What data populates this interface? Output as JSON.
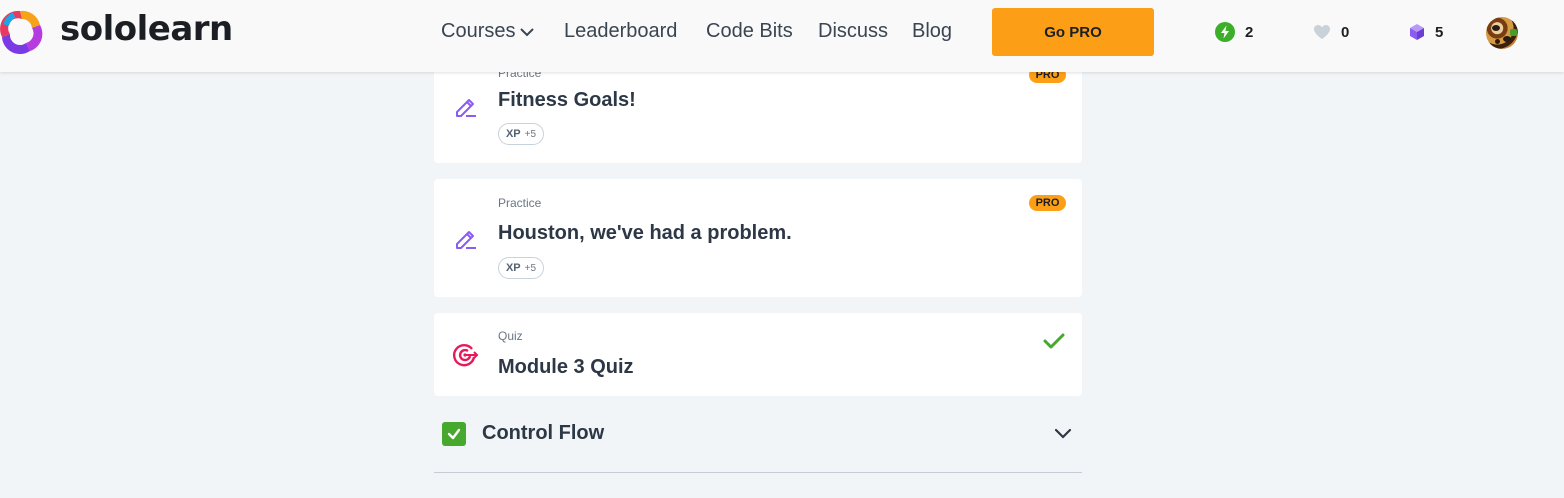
{
  "header": {
    "brand": "sololearn",
    "nav": {
      "courses": "Courses",
      "leaderboard": "Leaderboard",
      "code_bits": "Code Bits",
      "discuss": "Discuss",
      "blog": "Blog"
    },
    "go_pro": "Go PRO",
    "stats": {
      "streak": "2",
      "hearts": "0",
      "gems": "5"
    },
    "colors": {
      "go_pro": "#fd9f16",
      "streak": "#3cae2a",
      "gem": "#8a5cf0"
    }
  },
  "lessons": [
    {
      "type": "Practice",
      "title": "Fitness Goals!",
      "xp_label": "XP",
      "xp_value": "+5",
      "badge": "PRO",
      "icon": "edit-pencil-icon"
    },
    {
      "type": "Practice",
      "title": "Houston, we've had a problem.",
      "xp_label": "XP",
      "xp_value": "+5",
      "badge": "PRO",
      "icon": "edit-pencil-icon"
    },
    {
      "type": "Quiz",
      "title": "Module 3 Quiz",
      "completed": true,
      "icon": "target-icon"
    }
  ],
  "section": {
    "title": "Control Flow",
    "completed": true
  }
}
